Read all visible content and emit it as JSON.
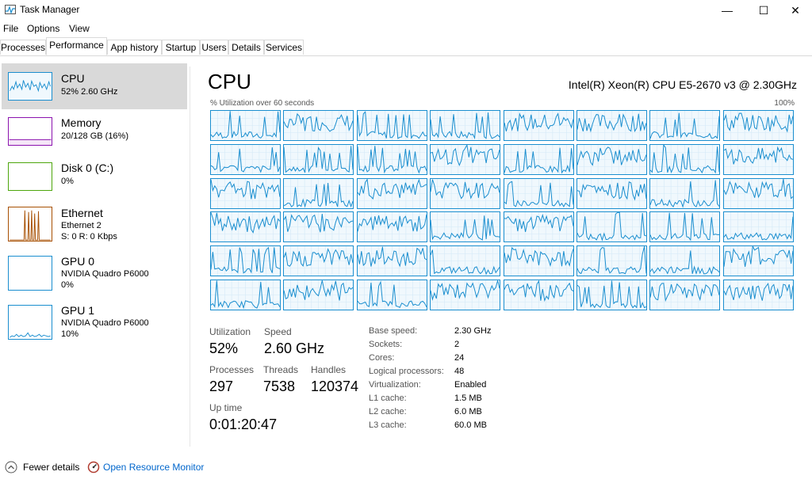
{
  "window": {
    "title": "Task Manager",
    "minimize": "—",
    "maximize": "☐",
    "close": "✕"
  },
  "menu": [
    "File",
    "Options",
    "View"
  ],
  "tabs": [
    "Processes",
    "Performance",
    "App history",
    "Startup",
    "Users",
    "Details",
    "Services"
  ],
  "active_tab": "Performance",
  "sidebar": [
    {
      "name": "CPU",
      "sub1": "52%  2.60 GHz",
      "sub2": "",
      "color": "#1a8ecf"
    },
    {
      "name": "Memory",
      "sub1": "20/128 GB (16%)",
      "sub2": "",
      "color": "#8b12ae"
    },
    {
      "name": "Disk 0 (C:)",
      "sub1": "0%",
      "sub2": "",
      "color": "#4da60c"
    },
    {
      "name": "Ethernet",
      "sub1": "Ethernet 2",
      "sub2": "S: 0  R: 0 Kbps",
      "color": "#a74f01"
    },
    {
      "name": "GPU 0",
      "sub1": "NVIDIA Quadro P6000",
      "sub2": "0%",
      "color": "#1a8ecf"
    },
    {
      "name": "GPU 1",
      "sub1": "NVIDIA Quadro P6000",
      "sub2": "10%",
      "color": "#1a8ecf"
    }
  ],
  "main": {
    "title": "CPU",
    "model": "Intel(R) Xeon(R) CPU E5-2670 v3 @ 2.30GHz",
    "util_label": "% Utilization over 60 seconds",
    "util_max": "100%",
    "processor_count": 48
  },
  "stats": {
    "utilization_label": "Utilization",
    "utilization": "52%",
    "speed_label": "Speed",
    "speed": "2.60 GHz",
    "processes_label": "Processes",
    "processes": "297",
    "threads_label": "Threads",
    "threads": "7538",
    "handles_label": "Handles",
    "handles": "120374",
    "uptime_label": "Up time",
    "uptime": "0:01:20:47"
  },
  "details": [
    {
      "label": "Base speed:",
      "value": "2.30 GHz"
    },
    {
      "label": "Sockets:",
      "value": "2"
    },
    {
      "label": "Cores:",
      "value": "24"
    },
    {
      "label": "Logical processors:",
      "value": "48"
    },
    {
      "label": "Virtualization:",
      "value": "Enabled"
    },
    {
      "label": "L1 cache:",
      "value": "1.5 MB"
    },
    {
      "label": "L2 cache:",
      "value": "6.0 MB"
    },
    {
      "label": "L3 cache:",
      "value": "60.0 MB"
    }
  ],
  "footer": {
    "fewer_details": "Fewer details",
    "open_resource_monitor": "Open Resource Monitor"
  },
  "colors": {
    "cpu_line": "#1a8ecf",
    "selected_bg": "#d9d9d9",
    "link": "#0066cc"
  }
}
